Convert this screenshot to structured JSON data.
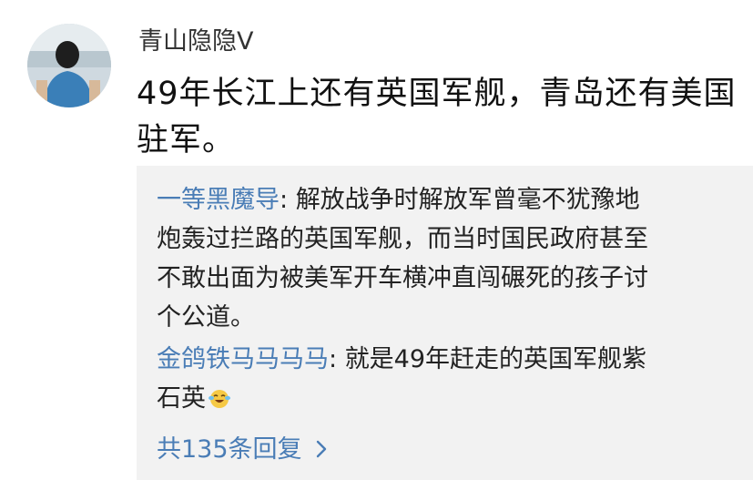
{
  "post": {
    "username": "青山隐隐V",
    "text_line1": "49年长江上还有英国军舰，青岛还有美国",
    "text_line2": "驻军。"
  },
  "replies": [
    {
      "author": "一等黑魔导",
      "separator": ": ",
      "lines": [
        "解放战争时解放军曾毫不犹豫地",
        "炮轰过拦路的英国军舰，而当时国民政府甚至",
        "不敢出面为被美军开车横冲直闯碾死的孩子讨",
        "个公道。"
      ]
    },
    {
      "author": "金鸽铁马马马马",
      "separator": ": ",
      "lines": [
        "就是49年赶走的英国军舰紫",
        "石英"
      ],
      "emoji": "laughing-crying-emoji-icon"
    }
  ],
  "more_replies_label": "共135条回复",
  "icons": {
    "avatar": "avatar-photo",
    "more": "chevron-right-icon"
  },
  "colors": {
    "link": "#4a7db6",
    "reply_background": "#f2f2f2"
  }
}
